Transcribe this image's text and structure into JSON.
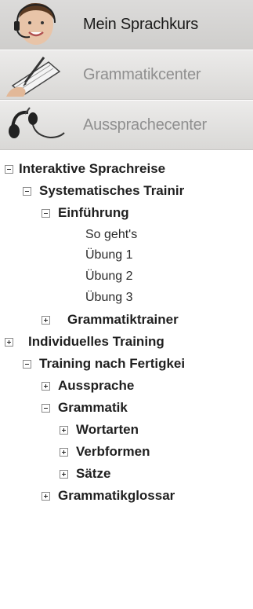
{
  "nav": [
    {
      "label": "Mein Sprachkurs",
      "icon": "headset-person-icon",
      "active": true
    },
    {
      "label": "Grammatikcenter",
      "icon": "pen-clipboard-icon",
      "active": false
    },
    {
      "label": "Aussprachecenter",
      "icon": "headphones-icon",
      "active": false
    }
  ],
  "tree": {
    "root": "Interaktive Sprachreise",
    "systematic": "Systematisches Trainir",
    "einfuehrung": "Einführung",
    "leaves": [
      "So geht's",
      "Übung 1",
      "Übung 2",
      "Übung 3"
    ],
    "grammatiktrainer": "Grammatiktrainer",
    "individuell": "Individuelles Training",
    "fertigkeiten": "Training nach Fertigkei",
    "aussprache": "Aussprache",
    "grammatik": "Grammatik",
    "wortarten": "Wortarten",
    "verbformen": "Verbformen",
    "saetze": "Sätze",
    "glossar": "Grammatikglossar"
  },
  "colors": {
    "active_bg": "#d6d5d3",
    "text": "#1f1f1f",
    "dim": "#8f8f8f"
  }
}
